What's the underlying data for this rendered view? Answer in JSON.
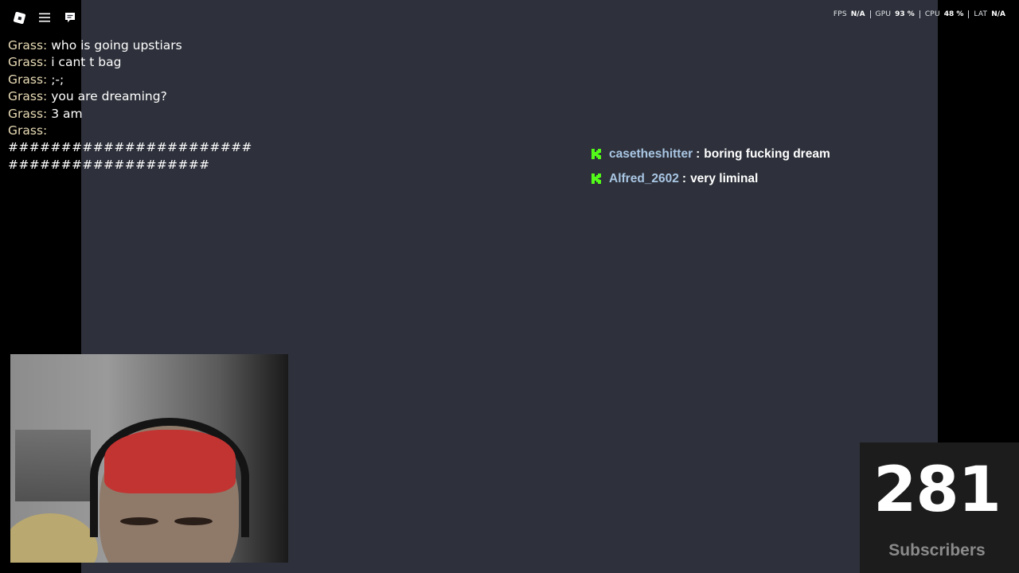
{
  "toolbar": {
    "icons": [
      "roblox-menu-icon",
      "hamburger-menu-icon",
      "chat-bubble-icon"
    ]
  },
  "stats": {
    "fps": {
      "label": "FPS",
      "value": "N/A"
    },
    "gpu": {
      "label": "GPU",
      "value": "93 %"
    },
    "cpu": {
      "label": "CPU",
      "value": "48 %"
    },
    "lat": {
      "label": "LAT",
      "value": "N/A"
    }
  },
  "game_chat": {
    "lines": [
      {
        "name": "Grass:",
        "text": "who is going upstiars"
      },
      {
        "name": "Grass:",
        "text": "i cant t bag"
      },
      {
        "name": "Grass:",
        "text": ";-;"
      },
      {
        "name": "Grass:",
        "text": "you are dreaming?"
      },
      {
        "name": "Grass:",
        "text": "3 am"
      },
      {
        "name": "Grass:",
        "text": ""
      }
    ],
    "hash_lines": [
      "#######################",
      "###################"
    ]
  },
  "stream_chat": {
    "badge_icon": "kick-icon",
    "badge_color": "#53fc18",
    "messages": [
      {
        "user": "casetheshitter",
        "sep": ":",
        "text": "boring fucking dream"
      },
      {
        "user": "Alfred_2602",
        "sep": ":",
        "text": "very liminal"
      }
    ]
  },
  "subscribers": {
    "count": "281",
    "label": "Subscribers"
  }
}
